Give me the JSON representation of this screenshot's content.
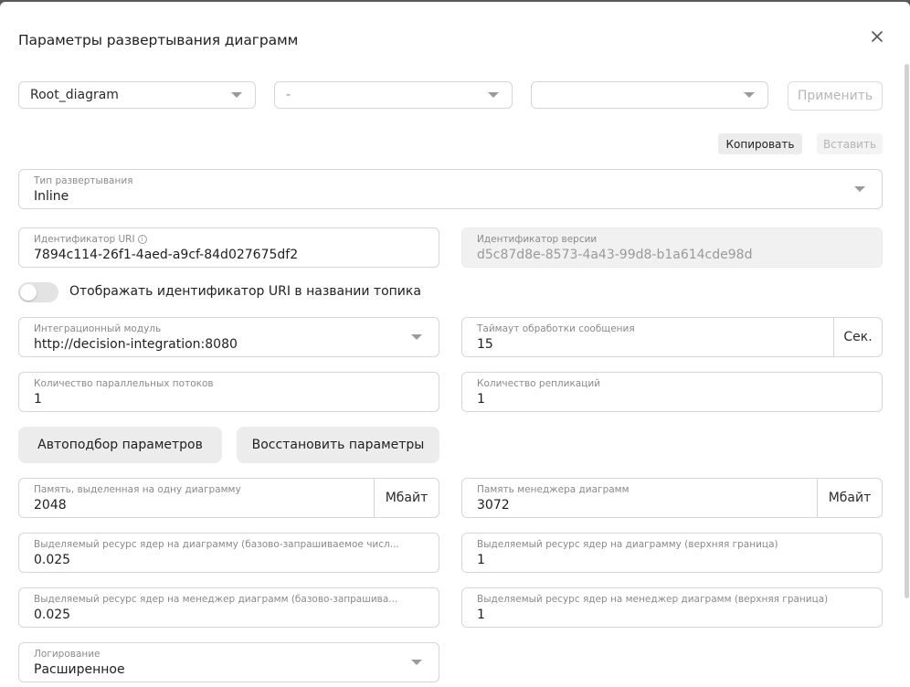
{
  "dialog": {
    "title": "Параметры развертывания диаграмм"
  },
  "selectors": {
    "diagram": "Root_diagram",
    "second": "-",
    "third": "",
    "apply_label": "Применить"
  },
  "clipboard": {
    "copy_label": "Копировать",
    "paste_label": "Вставить"
  },
  "deployment_type": {
    "label": "Тип развертывания",
    "value": "Inline"
  },
  "uri_id": {
    "label": "Идентификатор URI",
    "value": "7894c114-26f1-4aed-a9cf-84d027675df2"
  },
  "version_id": {
    "label": "Идентификатор версии",
    "value": "d5c87d8e-8573-4a43-99d8-b1a614cde98d"
  },
  "show_uri_toggle": {
    "label": "Отображать идентификатор URI в названии топика",
    "checked": false
  },
  "integration_module": {
    "label": "Интеграционный модуль",
    "value": "http://decision-integration:8080"
  },
  "message_timeout": {
    "label": "Таймаут обработки сообщения",
    "value": "15",
    "unit": "Сек."
  },
  "parallel_threads": {
    "label": "Количество параллельных потоков",
    "value": "1"
  },
  "replications": {
    "label": "Количество репликаций",
    "value": "1"
  },
  "buttons": {
    "autoselect": "Автоподбор параметров",
    "restore": "Восстановить параметры"
  },
  "memory_per_diagram": {
    "label": "Память, выделенная на одну диаграмму",
    "value": "2048",
    "unit": "Мбайт"
  },
  "manager_memory": {
    "label": "Память менеджера диаграмм",
    "value": "3072",
    "unit": "Мбайт"
  },
  "cpu_diagram_base": {
    "label": "Выделяемый ресурс ядер на диаграмму (базово-запрашиваемое числ...",
    "value": "0.025"
  },
  "cpu_diagram_limit": {
    "label": "Выделяемый ресурс ядер на диаграмму (верхняя граница)",
    "value": "1"
  },
  "cpu_manager_base": {
    "label": "Выделяемый ресурс ядер на менеджер диаграмм (базово-запрашива...",
    "value": "0.025"
  },
  "cpu_manager_limit": {
    "label": "Выделяемый ресурс ядер на менеджер диаграмм (верхняя граница)",
    "value": "1"
  },
  "logging": {
    "label": "Логирование",
    "value": "Расширенное"
  }
}
